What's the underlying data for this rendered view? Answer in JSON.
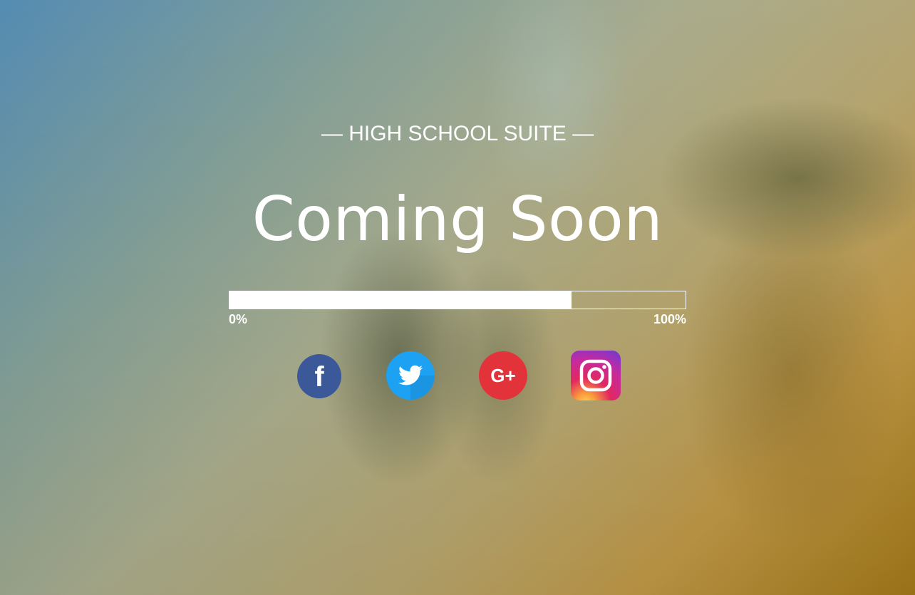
{
  "page": {
    "subtitle": "— HIGH SCHOOL SUITE —",
    "headline": "Coming Soon"
  },
  "progress": {
    "value_percent": 75,
    "min_label": "0%",
    "max_label": "100%"
  },
  "social": [
    {
      "icon": "facebook-icon",
      "label": "f",
      "color": "#3b5998"
    },
    {
      "icon": "twitter-icon",
      "color": "#1da1f2"
    },
    {
      "icon": "google-plus-icon",
      "label": "G+",
      "color": "#e2333b"
    },
    {
      "icon": "instagram-icon",
      "color": "#d6249f"
    }
  ]
}
